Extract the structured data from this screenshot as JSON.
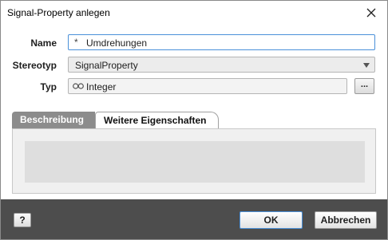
{
  "window": {
    "title": "Signal-Property anlegen",
    "close_icon": "close-icon"
  },
  "form": {
    "name": {
      "label": "Name",
      "required_marker": "*",
      "value": "Umdrehungen"
    },
    "stereotyp": {
      "label": "Stereotyp",
      "value": "SignalProperty",
      "icon": "chevron-down-icon"
    },
    "typ": {
      "label": "Typ",
      "value": "Integer",
      "icon": "link-icon",
      "browse_label": "..."
    }
  },
  "tabs": [
    {
      "label": "Beschreibung",
      "active": false
    },
    {
      "label": "Weitere Eigenschaften",
      "active": true
    }
  ],
  "footer": {
    "help_label": "?",
    "ok_label": "OK",
    "cancel_label": "Abbrechen"
  },
  "colors": {
    "footer_bg": "#4d4d4d",
    "focus_border": "#4a90d9",
    "inactive_tab": "#8c8c8c"
  }
}
